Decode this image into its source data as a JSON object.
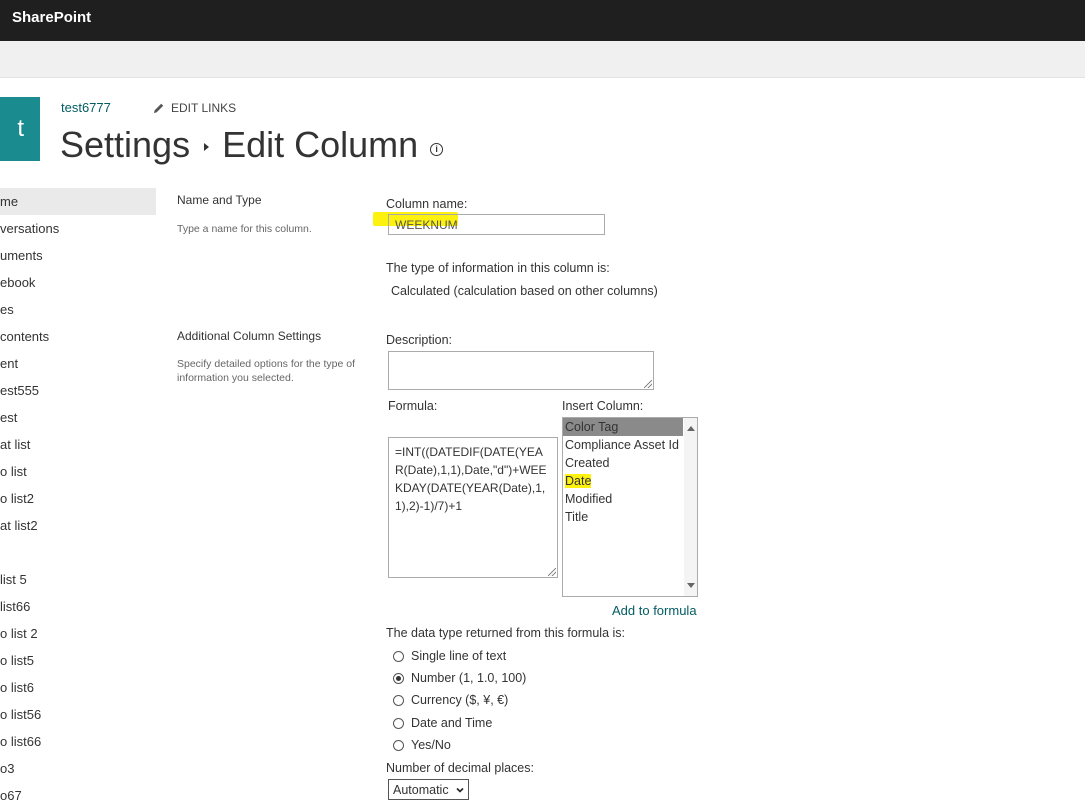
{
  "suitebar": {
    "brand": "SharePoint"
  },
  "site": {
    "logo_letter": "t",
    "name": "test6777",
    "edit_links": "EDIT LINKS"
  },
  "title": {
    "part1": "Settings",
    "part2": "Edit Column"
  },
  "leftnav": {
    "items": [
      {
        "label": "me",
        "selected": true
      },
      {
        "label": "versations"
      },
      {
        "label": "uments"
      },
      {
        "label": "ebook"
      },
      {
        "label": "es"
      },
      {
        "label": "contents"
      },
      {
        "label": "ent"
      },
      {
        "label": "est555"
      },
      {
        "label": "est"
      },
      {
        "label": "at list"
      },
      {
        "label": "o list"
      },
      {
        "label": "o list2"
      },
      {
        "label": "at list2"
      },
      {
        "label": ""
      },
      {
        "label": "list 5"
      },
      {
        "label": "list66"
      },
      {
        "label": "o list 2"
      },
      {
        "label": "o list5"
      },
      {
        "label": "o list6"
      },
      {
        "label": "o list56"
      },
      {
        "label": "o list66"
      },
      {
        "label": "o3"
      },
      {
        "label": "o67"
      }
    ]
  },
  "name_type": {
    "section_title": "Name and Type",
    "section_desc": "Type a name for this column.",
    "column_name_label": "Column name:",
    "column_name_value": "WEEKNUM",
    "type_label": "The type of information in this column is:",
    "type_value": "Calculated (calculation based on other columns)"
  },
  "additional": {
    "section_title": "Additional Column Settings",
    "section_desc": "Specify detailed options for the type of information you selected.",
    "description_label": "Description:",
    "formula_label": "Formula:",
    "formula_value": "=INT((DATEDIF(DATE(YEAR(Date),1,1),Date,\"d\")+WEEKDAY(DATE(YEAR(Date),1,1),2)-1)/7)+1",
    "insert_column_label": "Insert Column:",
    "insert_columns": [
      "Color Tag",
      "Compliance Asset Id",
      "Created",
      "Date",
      "Modified",
      "Title"
    ],
    "add_to_formula": "Add to formula",
    "return_type_label": "The data type returned from this formula is:",
    "return_types": [
      {
        "label": "Single line of text",
        "checked": false
      },
      {
        "label": "Number (1, 1.0, 100)",
        "checked": true
      },
      {
        "label": "Currency ($, ¥, €)",
        "checked": false
      },
      {
        "label": "Date and Time",
        "checked": false
      },
      {
        "label": "Yes/No",
        "checked": false
      }
    ],
    "decimal_label": "Number of decimal places:",
    "decimal_value": "Automatic"
  },
  "colors": {
    "accent": "#035c63",
    "logo": "#1a8b8e",
    "highlight": "#fdf20f"
  }
}
